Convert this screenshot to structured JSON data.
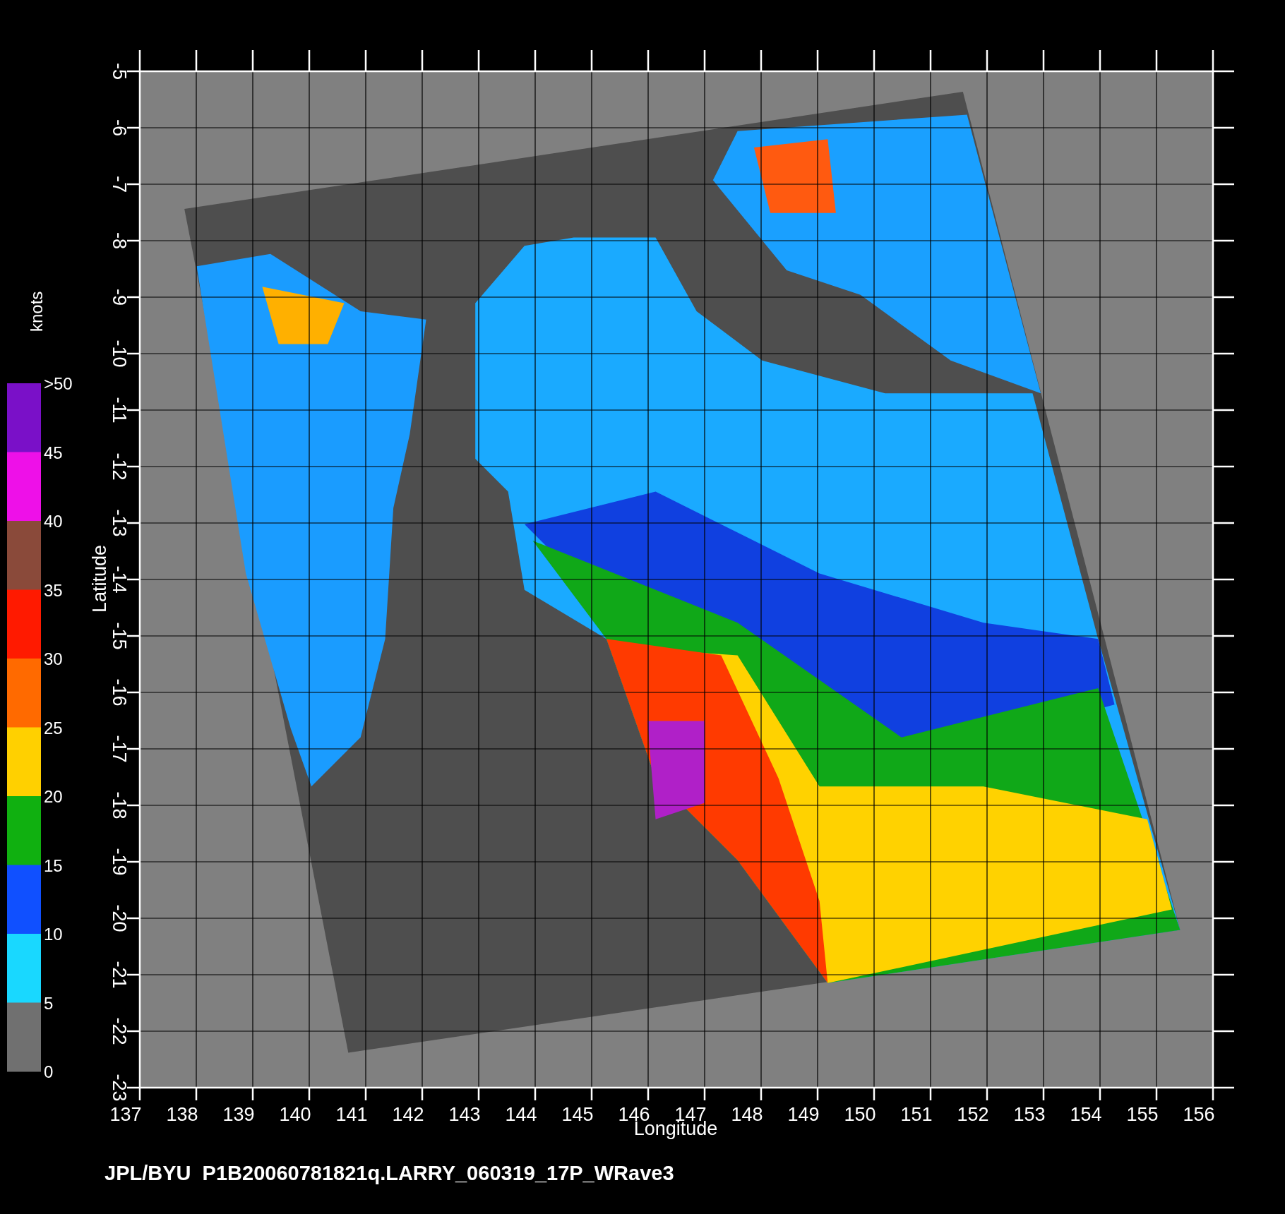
{
  "plot": {
    "xlabel": "Longitude",
    "ylabel": "Latitude",
    "xticks": [
      "137",
      "138",
      "139",
      "140",
      "141",
      "142",
      "143",
      "144",
      "145",
      "146",
      "147",
      "148",
      "149",
      "150",
      "151",
      "152",
      "153",
      "154",
      "155",
      "156"
    ],
    "yticks": [
      "-5",
      "-6",
      "-7",
      "-8",
      "-9",
      "-10",
      "-11",
      "-12",
      "-13",
      "-14",
      "-15",
      "-16",
      "-17",
      "-18",
      "-19",
      "-20",
      "-21",
      "-22",
      "-23"
    ]
  },
  "colorbar": {
    "unit": "knots",
    "labels": [
      ">50",
      "45",
      "40",
      "35",
      "30",
      "25",
      "20",
      "15",
      "10",
      "5",
      "0"
    ],
    "segments": [
      {
        "color": "#7a10c8"
      },
      {
        "color": "#ee10e8"
      },
      {
        "color": "#8a4a3a"
      },
      {
        "color": "#ff1a00"
      },
      {
        "color": "#ff6a00"
      },
      {
        "color": "#ffd000"
      },
      {
        "color": "#10b010"
      },
      {
        "color": "#1050ff"
      },
      {
        "color": "#19d8ff"
      },
      {
        "color": "#707070"
      }
    ]
  },
  "footer": "JPL/BYU  P1B20060781821q.LARRY_060319_17P_WRave3"
}
